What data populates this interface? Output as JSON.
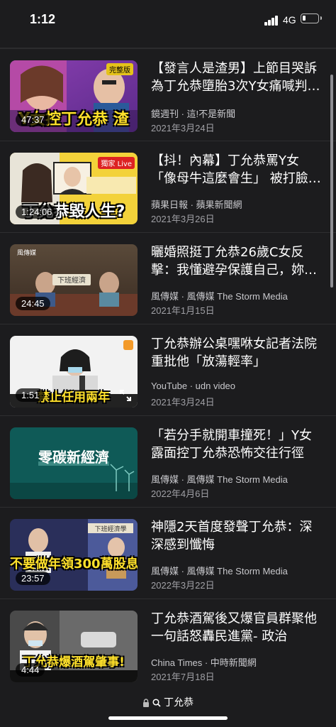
{
  "status": {
    "time": "1:12",
    "network": "4G"
  },
  "videos": [
    {
      "title": "【發言人是渣男】上節目哭訴為丁允恭墮胎3次Y女痛喊判…",
      "source": "鏡週刊 · 這!不是新聞",
      "date": "2021年3月24日",
      "duration": "47:37",
      "caption": "Y女控丁允恭 渣",
      "tag": "完整版"
    },
    {
      "title": "【抖！內幕】丁允恭罵Y女「像母牛這麼會生」 被打臉…",
      "source": "蘋果日報 · 蘋果新聞網",
      "date": "2021年3月26日",
      "duration": "1:24:06",
      "caption": "丁允恭毀人生?",
      "tag": "獨家 Live"
    },
    {
      "title": "曬婚照挺丁允恭26歲C女反擊：我懂避孕保護自己，妳…",
      "source": "風傳媒 · 風傳媒 The Storm Media",
      "date": "2021年1月15日",
      "duration": "24:45",
      "caption": "",
      "tag": "下班經濟"
    },
    {
      "title": "丁允恭辦公桌嘿咻女記者法院重批他「放蕩輕率」",
      "source": "YouTube · udn video",
      "date": "2021年3月24日",
      "duration": "1:51",
      "caption": "禁止任用兩年",
      "tag": ""
    },
    {
      "title": "「若分手就開車撞死！」Y女露面控丁允恭恐怖交往行徑",
      "source": "風傳媒 · 風傳媒 The Storm Media",
      "date": "2022年4月6日",
      "duration": "",
      "caption": "零碳新經濟",
      "tag": ""
    },
    {
      "title": "神隱2天首度發聲丁允恭：深深感到懺悔",
      "source": "風傳媒 · 風傳媒 The Storm Media",
      "date": "2022年3月22日",
      "duration": "23:57",
      "caption": "不要做年領300萬股息",
      "tag": "下班經濟學"
    },
    {
      "title": "丁允恭酒駕後又爆官員群聚他一句話怒轟民進黨- 政治",
      "source": "China Times · 中時新聞網",
      "date": "2021年7月18日",
      "duration": "4:44",
      "caption": "丁允恭爆酒駕肇事!",
      "tag": ""
    }
  ],
  "browser": {
    "url": "丁允恭"
  }
}
